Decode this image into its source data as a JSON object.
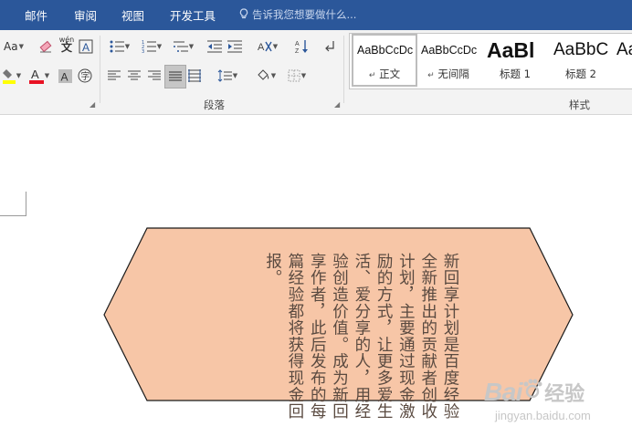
{
  "menu": {
    "tabs": [
      {
        "label": "邮件"
      },
      {
        "label": "审阅"
      },
      {
        "label": "视图"
      },
      {
        "label": "开发工具"
      }
    ],
    "tell_me": "告诉我您想要做什么..."
  },
  "ribbon": {
    "font_size_label": "Aa",
    "phonetic_label": "wén",
    "paragraph_group": "段落",
    "styles_group": "样式",
    "styles": [
      {
        "preview": "AaBbCcDc",
        "name": "正文",
        "mark": "↵"
      },
      {
        "preview": "AaBbCcDc",
        "name": "无间隔",
        "mark": "↵"
      },
      {
        "preview": "AaBl",
        "name": "标题 1"
      },
      {
        "preview": "AaBbC",
        "name": "标题 2"
      },
      {
        "preview": "Aa",
        "name": ""
      }
    ],
    "colors": {
      "highlight": "#ffff00",
      "font_color": "#e81123"
    }
  },
  "document": {
    "shape_fill": "#f7c6a7",
    "shape_text": "新回享计划是百度经验全新推出的贡献者创收计划，主要通过现金激励的方式，让更多爱生活、爱分享的人，用经验创造价值。成为新回享作者，此后发布的每篇经验都将获得现金回报。"
  },
  "watermark": {
    "logo": "Bai",
    "logo_tail": "经验",
    "url": "jingyan.baidu.com"
  }
}
